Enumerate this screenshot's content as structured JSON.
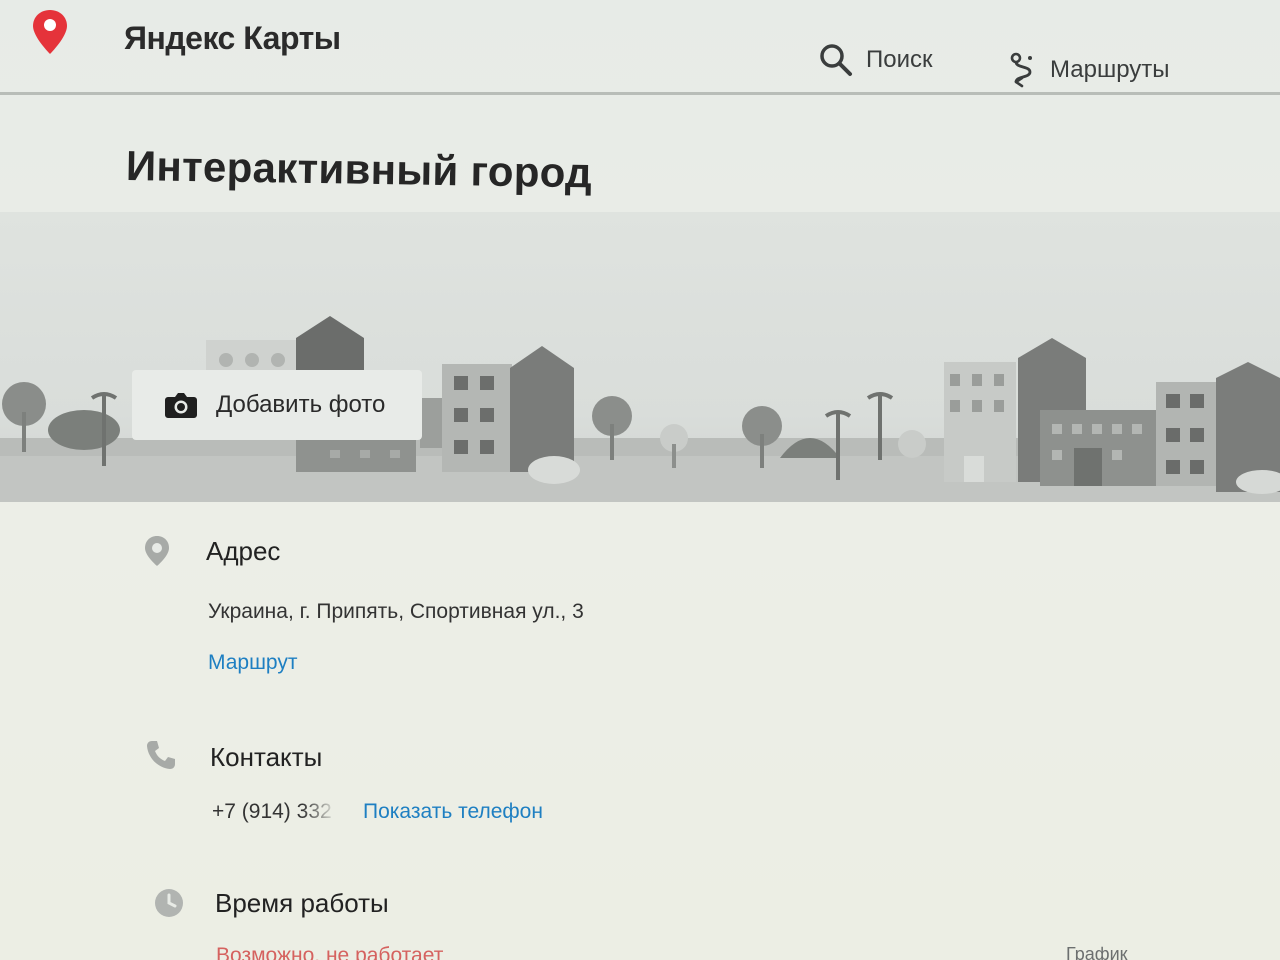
{
  "app": {
    "name": "Яндекс Карты",
    "brand_color": "#e5333a"
  },
  "nav": {
    "search_label": "Поиск",
    "search_icon": "search-icon",
    "routes_label": "Маршруты",
    "routes_icon": "route-icon"
  },
  "organization": {
    "title": "Интерактивный город",
    "add_photo_label": "Добавить фото",
    "add_photo_icon": "camera-icon"
  },
  "address": {
    "heading": "Адрес",
    "value": "Украина, г. Припять, Спортивная ул., 3",
    "route_link": "Маршрут",
    "icon": "location-pin-icon"
  },
  "contacts": {
    "heading": "Контакты",
    "phone_partial": "+7 (914) 332",
    "show_phone_link": "Показать телефон",
    "icon": "phone-icon",
    "link_color": "#1e7fc2"
  },
  "hours": {
    "heading": "Время работы",
    "status": "Возможно, не работает",
    "schedule_link": "График",
    "icon": "clock-icon",
    "status_color": "#d14a48"
  }
}
